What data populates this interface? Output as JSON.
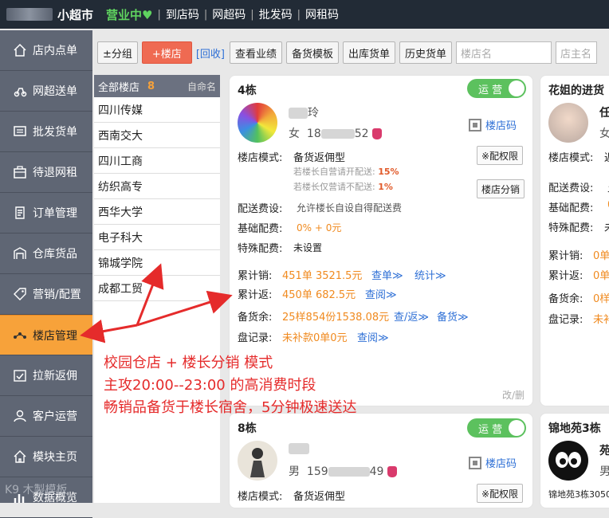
{
  "topbar": {
    "title": "小超市",
    "status": "营业中♥",
    "sep": "|",
    "links": [
      "到店码",
      "网超码",
      "批发码",
      "网租码"
    ]
  },
  "sidebar": {
    "items": [
      {
        "label": "店内点单",
        "icon": "home-icon"
      },
      {
        "label": "网超送单",
        "icon": "delivery-icon"
      },
      {
        "label": "批发货单",
        "icon": "truck-icon"
      },
      {
        "label": "待退网租",
        "icon": "box-icon"
      },
      {
        "label": "订单管理",
        "icon": "order-icon"
      },
      {
        "label": "仓库货品",
        "icon": "warehouse-icon"
      },
      {
        "label": "营销/配置",
        "icon": "tag-icon"
      },
      {
        "label": "楼店管理",
        "icon": "network-icon"
      },
      {
        "label": "拉新返佣",
        "icon": "checkin-icon"
      },
      {
        "label": "客户运营",
        "icon": "users-icon"
      },
      {
        "label": "模块主页",
        "icon": "house-icon"
      },
      {
        "label": "数据概览",
        "icon": "chart-icon"
      }
    ],
    "watermark": "K9 木製模板"
  },
  "toolbar": {
    "group_btn": "±分组",
    "add_store_btn": "+楼店",
    "recycle_link": "[回收]",
    "perf_btn": "查看业绩",
    "template_btn": "备货模板",
    "outbound_btn": "出库货单",
    "history_btn": "历史货单",
    "store_name_placeholder": "楼店名",
    "owner_placeholder": "店主名"
  },
  "store_list": {
    "header": "全部楼店",
    "count": "8",
    "auto_name": "自命名",
    "stores": [
      "四川传媒",
      "西南交大",
      "四川工商",
      "纺织高专",
      "西华大学",
      "电子科大",
      "锦城学院",
      "成都工贸"
    ]
  },
  "card1": {
    "name": "4栋",
    "toggle": "运 营",
    "person_name_tail": "玲",
    "gender": "女",
    "phone_head": "18",
    "phone_tail": "52",
    "qr_link": "楼店码",
    "mode_label": "楼店模式:",
    "mode_value": "备货返佣型",
    "perm_btn": "※配权限",
    "sub1": "若楼长自营请开配送:",
    "sub1_val": "15%",
    "sub2": "若楼长仅营请不配送:",
    "sub2_val": "1%",
    "split_btn": "楼店分销",
    "delivery_label": "配送费设:",
    "delivery_value": "允许楼长自设自得配送费",
    "base_label": "基础配费:",
    "base_value": "0% + 0元",
    "special_label": "特殊配费:",
    "special_value": "未设置",
    "sales_label": "累计销:",
    "sales_value": "451单 3521.5元",
    "sales_link1": "查单≫",
    "sales_link2": "统计≫",
    "return_label": "累计返:",
    "return_value": "450单 682.5元",
    "return_link": "查阅≫",
    "stock_label": "备货余:",
    "stock_value": "25样854份1538.08元",
    "stock_link1": "查/返≫",
    "stock_link2": "备货≫",
    "inv_label": "盘记录:",
    "inv_value": "未补款0单0元",
    "inv_link": "查阅≫",
    "edit": "改/删"
  },
  "card2": {
    "name": "8栋",
    "toggle": "运 营",
    "gender": "男",
    "phone_head": "159",
    "phone_tail": "49",
    "qr_link": "楼店码",
    "mode_label": "楼店模式:",
    "mode_value": "备货返佣型",
    "perm_btn": "※配权限"
  },
  "card3": {
    "name": "花姐的进货",
    "person_head": "任",
    "gender": "女",
    "mode_label": "楼店模式:",
    "mode_value": "返",
    "delivery_label": "配送费设:",
    "delivery_value": "允",
    "base_label": "基础配费:",
    "base_value": "0",
    "special_label": "特殊配费:",
    "special_value": "未",
    "sales_label": "累计销:",
    "sales_value": "0单",
    "return_label": "累计返:",
    "return_value": "0单",
    "stock_label": "备货余:",
    "stock_value": "0样",
    "inv_label": "盘记录:",
    "inv_value": "未补"
  },
  "card4": {
    "name": "锦地苑3栋",
    "person_head": "苑",
    "gender": "男",
    "desc": "锦地苑3栋3050"
  },
  "annotation": {
    "line1": "校园仓店 + 楼长分销 模式",
    "line2": "主攻20:00--23:00 的高消费时段",
    "line3": "畅销品备货于楼长宿舍，5分钟极速送达"
  },
  "colors": {
    "accent": "#f7a23a",
    "run": "#5cc15e",
    "arrow": "#e52b2b",
    "link": "#2f70d6"
  }
}
